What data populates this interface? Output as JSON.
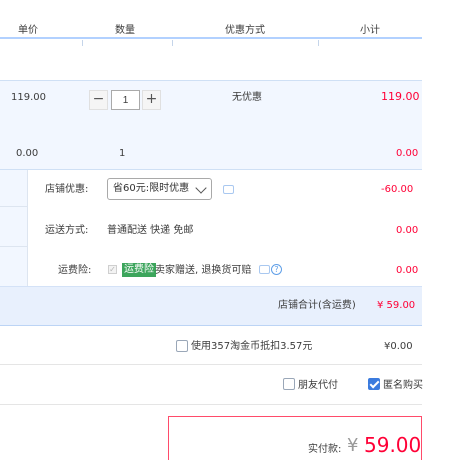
{
  "header": {
    "price_label": "单价",
    "qty_label": "数量",
    "discount_label": "优惠方式",
    "subtotal_label": "小计"
  },
  "item": {
    "price": "119.00",
    "qty_minus": "−",
    "qty_value": "1",
    "qty_plus": "+",
    "discount": "无优惠",
    "subtotal": "119.00"
  },
  "extra_row": {
    "price": "0.00",
    "qty": "1",
    "subtotal": "0.00"
  },
  "shop": {
    "coupon_label": "店铺优惠:",
    "coupon_selected": "省60元:限时优惠",
    "coupon_amount": "-60.00",
    "shipping_label": "运送方式:",
    "shipping_value": "普通配送 快递 免邮",
    "shipping_amount": "0.00",
    "insurance_label": "运费险:",
    "insurance_check": "✓",
    "insurance_tag": "运费险",
    "insurance_desc": "卖家赠送, 退换货可赔",
    "insurance_help": "?",
    "insurance_amount": "0.00",
    "total_label": "店铺合计(含运费)",
    "total_value": "¥ 59.00"
  },
  "coins": {
    "label": "使用357淘金币抵扣3.57元",
    "amount": "¥0.00"
  },
  "options": {
    "friend_pay": "朋友代付",
    "anonymous": "匿名购买"
  },
  "payment": {
    "label": "实付款:",
    "currency": "¥",
    "amount": "59.00"
  },
  "colors": {
    "accent_red": "#ff0036",
    "accent_blue": "#3b7bde",
    "row_bg": "#f2f7ff"
  }
}
